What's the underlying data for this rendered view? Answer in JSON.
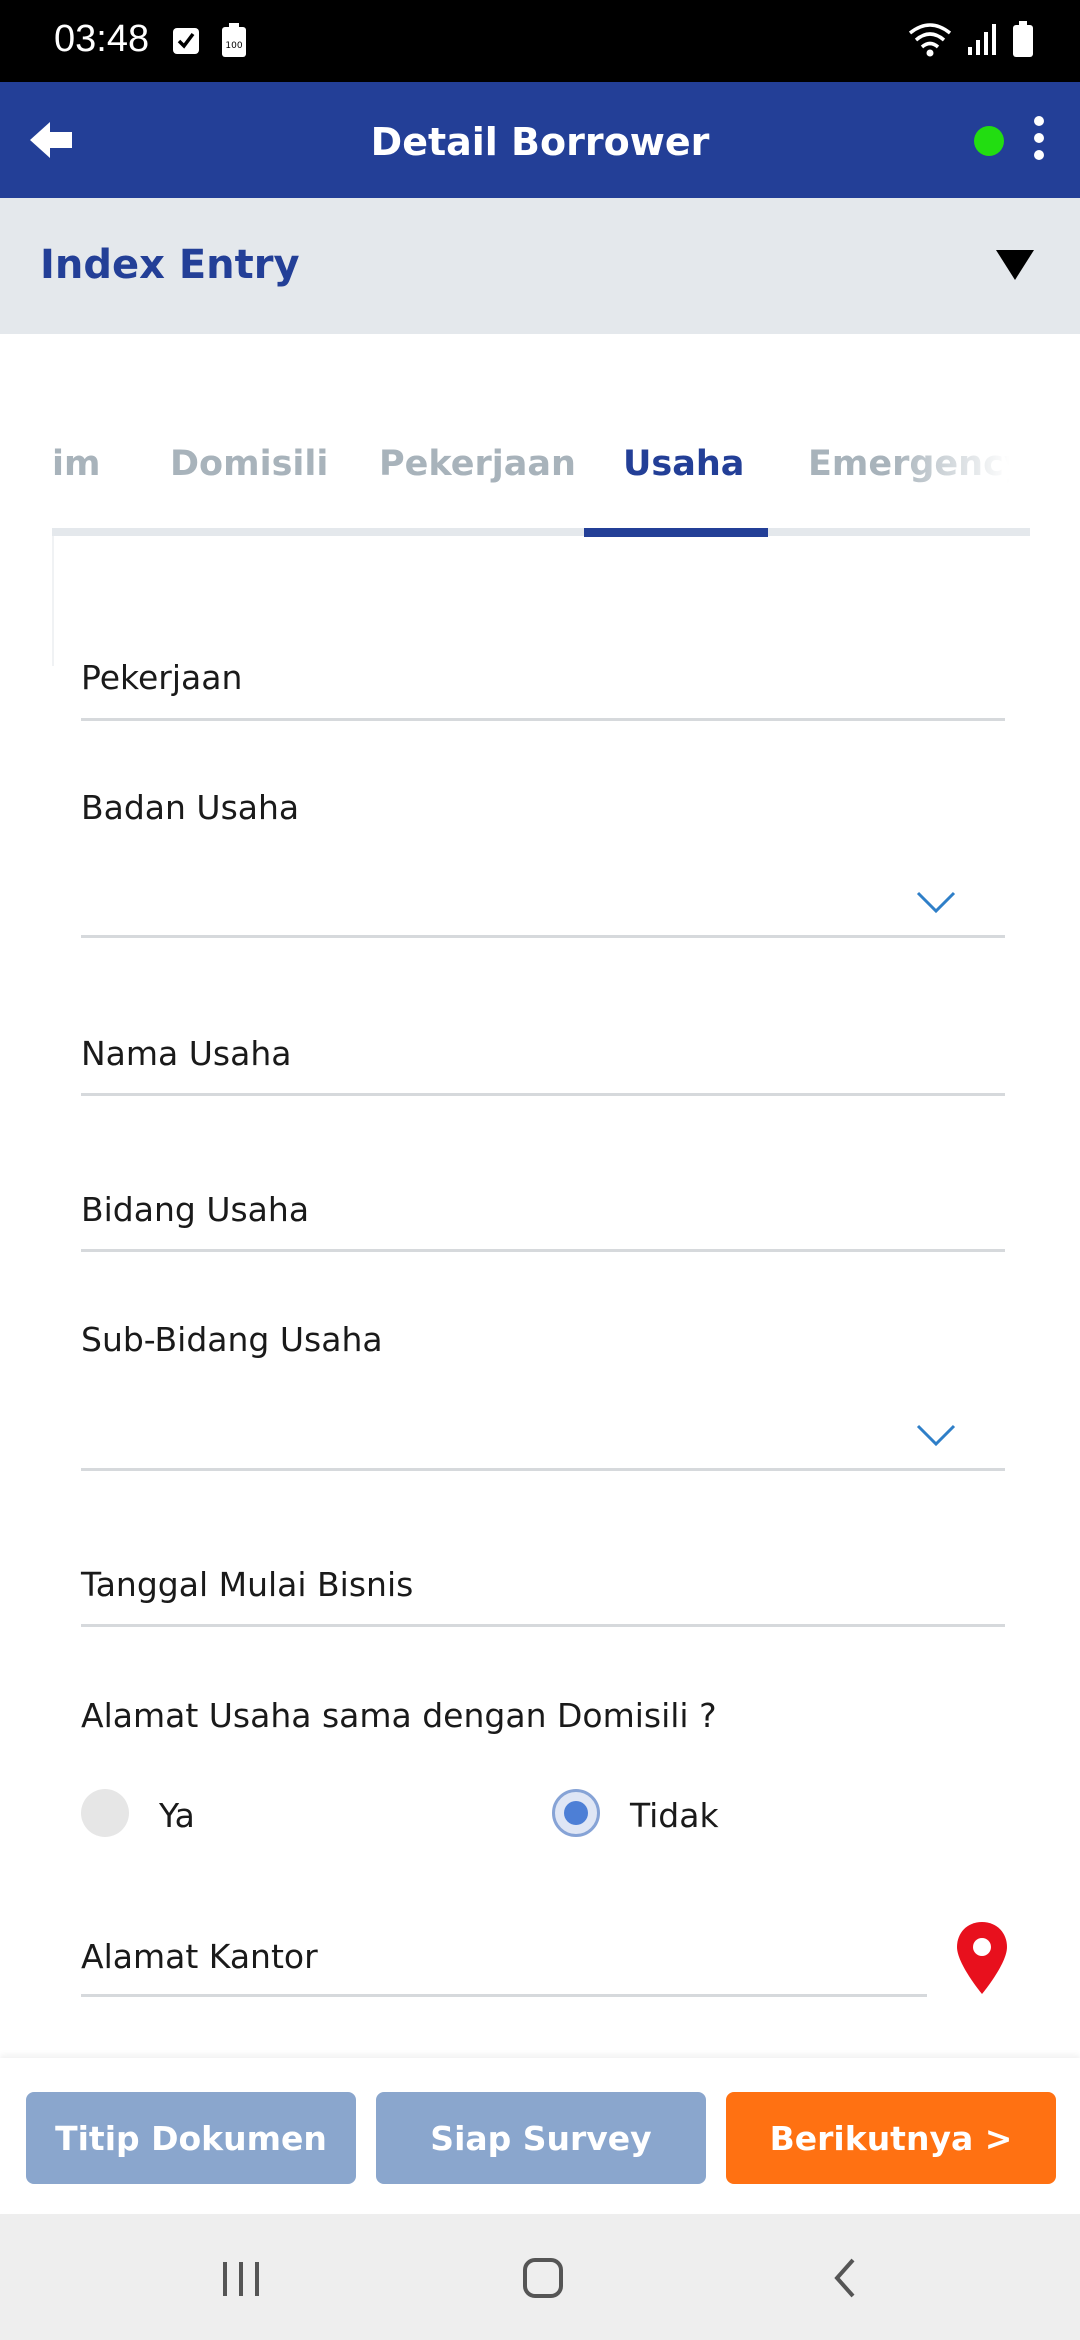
{
  "status_bar": {
    "time": "03:48",
    "left_icons": [
      "checkbox-notification-icon",
      "battery-100-icon"
    ],
    "right_icons": [
      "wifi-icon",
      "signal-icon",
      "battery-icon"
    ],
    "battery_badge": "100"
  },
  "app_bar": {
    "title": "Detail Borrower",
    "status_color": "#22dd11"
  },
  "section": {
    "title": "Index Entry"
  },
  "tabs": [
    {
      "label": "im",
      "active": false
    },
    {
      "label": "Domisili",
      "active": false
    },
    {
      "label": "Pekerjaan",
      "active": false
    },
    {
      "label": "Usaha",
      "active": true
    },
    {
      "label": "Emergency",
      "active": false
    }
  ],
  "form": {
    "pekerjaan_label": "Pekerjaan",
    "badan_usaha_label": "Badan Usaha",
    "nama_usaha_label": "Nama Usaha",
    "bidang_usaha_label": "Bidang Usaha",
    "sub_bidang_usaha_label": "Sub-Bidang Usaha",
    "tanggal_mulai_label": "Tanggal Mulai Bisnis",
    "alamat_question": "Alamat Usaha sama dengan Domisili ?",
    "radio_options": [
      {
        "label": "Ya",
        "selected": false
      },
      {
        "label": "Tidak",
        "selected": true
      }
    ],
    "alamat_kantor_label": "Alamat Kantor"
  },
  "actions": {
    "titip_dokumen": "Titip Dokumen",
    "siap_survey": "Siap Survey",
    "berikutnya": "Berikutnya >"
  },
  "colors": {
    "brand": "#233f97",
    "accent": "#ff7112",
    "muted_button": "#8aa6cd",
    "pin": "#e8101d"
  }
}
